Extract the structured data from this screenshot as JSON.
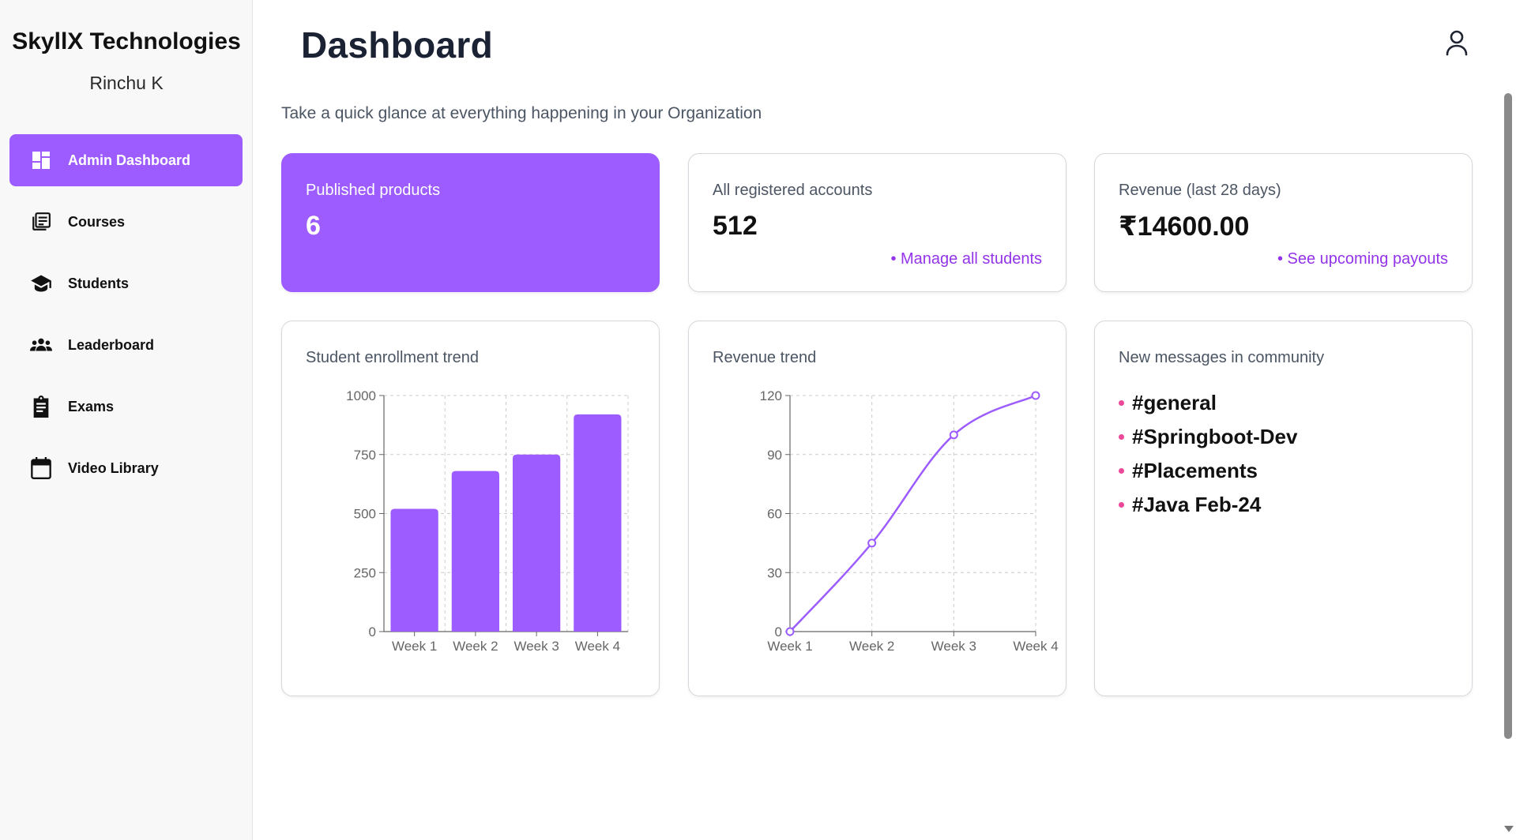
{
  "sidebar": {
    "brand": "SkyllX Technologies",
    "user_name": "Rinchu K",
    "items": [
      {
        "label": "Admin Dashboard",
        "icon": "dashboard-icon",
        "active": true
      },
      {
        "label": "Courses",
        "icon": "courses-icon",
        "active": false
      },
      {
        "label": "Students",
        "icon": "graduation-cap-icon",
        "active": false
      },
      {
        "label": "Leaderboard",
        "icon": "group-icon",
        "active": false
      },
      {
        "label": "Exams",
        "icon": "clipboard-icon",
        "active": false
      },
      {
        "label": "Video Library",
        "icon": "calendar-icon",
        "active": false
      }
    ]
  },
  "header": {
    "title": "Dashboard",
    "subtitle": "Take a quick glance at everything happening in your Organization",
    "profile_icon": "user-icon"
  },
  "stats": {
    "published": {
      "label": "Published products",
      "value": "6"
    },
    "accounts": {
      "label": "All registered accounts",
      "value": "512",
      "link": "• Manage all students"
    },
    "revenue": {
      "label": "Revenue (last 28 days)",
      "value": "₹14600.00",
      "link": "• See upcoming payouts"
    }
  },
  "colors": {
    "accent": "#9c5cff",
    "link": "#9333ea",
    "bullet": "#ec4899"
  },
  "charts": {
    "enrollment_title": "Student enrollment trend",
    "revenue_title": "Revenue trend"
  },
  "chart_data": [
    {
      "type": "bar",
      "title": "Student enrollment trend",
      "categories": [
        "Week 1",
        "Week 2",
        "Week 3",
        "Week 4"
      ],
      "values": [
        520,
        680,
        750,
        920
      ],
      "ylim": [
        0,
        1000
      ],
      "yticks": [
        0,
        250,
        500,
        750,
        1000
      ],
      "grid": true
    },
    {
      "type": "line",
      "title": "Revenue trend",
      "categories": [
        "Week 1",
        "Week 2",
        "Week 3",
        "Week 4"
      ],
      "values": [
        0,
        45,
        100,
        120
      ],
      "ylim": [
        0,
        120
      ],
      "yticks": [
        0,
        30,
        60,
        90,
        120
      ],
      "grid": true
    }
  ],
  "community": {
    "title": "New messages in community",
    "channels": [
      "#general",
      "#Springboot-Dev",
      "#Placements",
      "#Java Feb-24"
    ]
  }
}
